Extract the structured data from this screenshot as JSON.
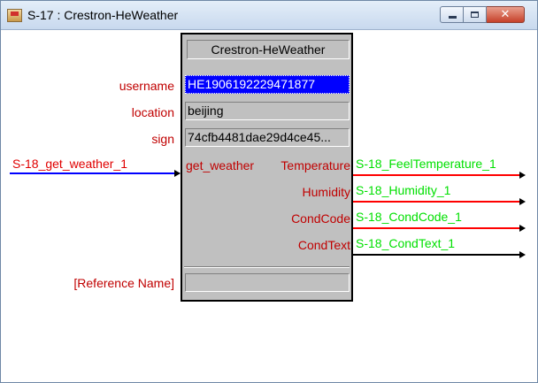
{
  "window": {
    "title": "S-17 : Crestron-HeWeather"
  },
  "colors": {
    "symbol_background": "#c0c0c0",
    "selected_field": "#0000ff",
    "pin_label": "#c00000",
    "signal_label": "#00e000",
    "digital_wire": "#0000ff",
    "analog_wire": "#ff0000",
    "serial_wire": "#000000"
  },
  "symbol": {
    "name": "Crestron-HeWeather",
    "parameters": [
      {
        "label": "username",
        "value": "HE1906192229471877",
        "selected": true
      },
      {
        "label": "location",
        "value": "beijing",
        "selected": false
      },
      {
        "label": "sign",
        "value": "74cfb4481dae29d4ce45...",
        "selected": false
      }
    ],
    "reference": {
      "label": "[Reference Name]",
      "value": ""
    },
    "inputs": [
      {
        "pin": "get_weather",
        "signal": "S-18_get_weather_1"
      }
    ],
    "outputs": [
      {
        "pin": "Temperature",
        "signal": "S-18_FeelTemperature_1"
      },
      {
        "pin": "Humidity",
        "signal": "S-18_Humidity_1"
      },
      {
        "pin": "CondCode",
        "signal": "S-18_CondCode_1"
      },
      {
        "pin": "CondText",
        "signal": "S-18_CondText_1"
      }
    ]
  }
}
